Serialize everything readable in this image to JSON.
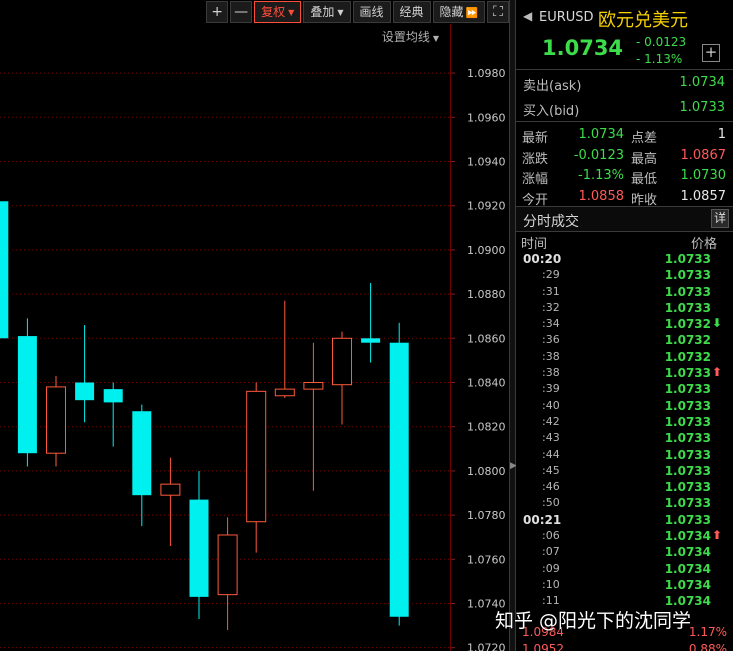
{
  "toolbar": {
    "zoom_in": "+",
    "zoom_out": "—",
    "restore_rights": "复权",
    "overlay": "叠加",
    "draw_line": "画线",
    "classic": "经典",
    "hide": "隐藏",
    "expand_icon": "⏩",
    "fullscreen_icon": "⛶"
  },
  "ma_setting": "设置均线",
  "chart_data": {
    "type": "candlestick",
    "y_ticks": [
      "1.0980",
      "1.0960",
      "1.0940",
      "1.0920",
      "1.0900",
      "1.0880",
      "1.0860",
      "1.0840",
      "1.0820",
      "1.0800",
      "1.0780",
      "1.0760",
      "1.0740",
      "1.0720"
    ],
    "ylim": [
      1.07185,
      1.09995
    ],
    "grid": true,
    "colors": {
      "up": "#ff5a3c",
      "down": "#00f0f0"
    },
    "candles": [
      {
        "open": 1.0922,
        "close": 1.086,
        "high": 1.093,
        "low": 1.0855
      },
      {
        "open": 1.0861,
        "close": 1.0808,
        "high": 1.0869,
        "low": 1.0802
      },
      {
        "open": 1.0808,
        "close": 1.0838,
        "high": 1.0843,
        "low": 1.0802
      },
      {
        "open": 1.084,
        "close": 1.0832,
        "high": 1.0866,
        "low": 1.0822
      },
      {
        "open": 1.0837,
        "close": 1.0831,
        "high": 1.084,
        "low": 1.0811
      },
      {
        "open": 1.0827,
        "close": 1.0789,
        "high": 1.083,
        "low": 1.0775
      },
      {
        "open": 1.0789,
        "close": 1.0794,
        "high": 1.0806,
        "low": 1.0766
      },
      {
        "open": 1.0787,
        "close": 1.0743,
        "high": 1.08,
        "low": 1.0733
      },
      {
        "open": 1.0744,
        "close": 1.0771,
        "high": 1.0779,
        "low": 1.0728
      },
      {
        "open": 1.0777,
        "close": 1.0836,
        "high": 1.084,
        "low": 1.0763
      },
      {
        "open": 1.0834,
        "close": 1.0837,
        "high": 1.0877,
        "low": 1.0833
      },
      {
        "open": 1.0837,
        "close": 1.084,
        "high": 1.0858,
        "low": 1.0791
      },
      {
        "open": 1.0839,
        "close": 1.086,
        "high": 1.0863,
        "low": 1.0821
      },
      {
        "open": 1.086,
        "close": 1.0858,
        "high": 1.0885,
        "low": 1.0849
      },
      {
        "open": 1.0858,
        "close": 1.0734,
        "high": 1.0867,
        "low": 1.073
      }
    ]
  },
  "quote": {
    "code": "EURUSD",
    "name": "欧元兑美元",
    "last": "1.0734",
    "change": "- 0.0123",
    "change_pct": "- 1.13%",
    "add_icon": "+",
    "ask_label": "卖出(ask)",
    "ask_value": "1.0734",
    "bid_label": "买入(bid)",
    "bid_value": "1.0733"
  },
  "stats": [
    {
      "l1": "最新",
      "v1": "1.0734",
      "c1": "green",
      "l2": "点差",
      "v2": "1",
      "c2": "white"
    },
    {
      "l1": "涨跌",
      "v1": "-0.0123",
      "c1": "green",
      "l2": "最高",
      "v2": "1.0867",
      "c2": "red"
    },
    {
      "l1": "涨幅",
      "v1": "-1.13%",
      "c1": "green",
      "l2": "最低",
      "v2": "1.0730",
      "c2": "green"
    },
    {
      "l1": "今开",
      "v1": "1.0858",
      "c1": "red",
      "l2": "昨收",
      "v2": "1.0857",
      "c2": "white"
    }
  ],
  "trades": {
    "title": "分时成交",
    "detail_label": "详",
    "col_time": "时间",
    "col_price": "价格",
    "rows": [
      {
        "time": "00:20",
        "major": true,
        "price": "1.0733",
        "arrow": ""
      },
      {
        "time": ":29",
        "major": false,
        "price": "1.0733",
        "arrow": ""
      },
      {
        "time": ":31",
        "major": false,
        "price": "1.0733",
        "arrow": ""
      },
      {
        "time": ":32",
        "major": false,
        "price": "1.0733",
        "arrow": ""
      },
      {
        "time": ":34",
        "major": false,
        "price": "1.0732",
        "arrow": "down"
      },
      {
        "time": ":36",
        "major": false,
        "price": "1.0732",
        "arrow": ""
      },
      {
        "time": ":38",
        "major": false,
        "price": "1.0732",
        "arrow": ""
      },
      {
        "time": ":38",
        "major": false,
        "price": "1.0733",
        "arrow": "up"
      },
      {
        "time": ":39",
        "major": false,
        "price": "1.0733",
        "arrow": ""
      },
      {
        "time": ":40",
        "major": false,
        "price": "1.0733",
        "arrow": ""
      },
      {
        "time": ":42",
        "major": false,
        "price": "1.0733",
        "arrow": ""
      },
      {
        "time": ":43",
        "major": false,
        "price": "1.0733",
        "arrow": ""
      },
      {
        "time": ":44",
        "major": false,
        "price": "1.0733",
        "arrow": ""
      },
      {
        "time": ":45",
        "major": false,
        "price": "1.0733",
        "arrow": ""
      },
      {
        "time": ":46",
        "major": false,
        "price": "1.0733",
        "arrow": ""
      },
      {
        "time": ":50",
        "major": false,
        "price": "1.0733",
        "arrow": ""
      },
      {
        "time": "00:21",
        "major": true,
        "price": "1.0733",
        "arrow": ""
      },
      {
        "time": ":06",
        "major": false,
        "price": "1.0734",
        "arrow": "up"
      },
      {
        "time": ":07",
        "major": false,
        "price": "1.0734",
        "arrow": ""
      },
      {
        "time": ":09",
        "major": false,
        "price": "1.0734",
        "arrow": ""
      },
      {
        "time": ":10",
        "major": false,
        "price": "1.0734",
        "arrow": ""
      },
      {
        "time": ":11",
        "major": false,
        "price": "1.0734",
        "arrow": ""
      }
    ],
    "arrow_up": "⬆",
    "arrow_down": "⬇"
  },
  "bottom": {
    "v1": "1.0984",
    "p1": "1.17%",
    "v2": "1.0952",
    "p2": "0.88%"
  },
  "watermark": "知乎 @阳光下的沈同学"
}
